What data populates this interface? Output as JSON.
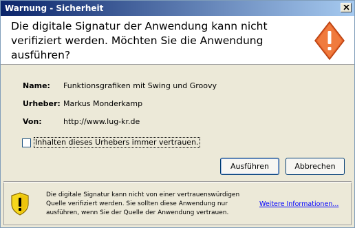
{
  "window": {
    "title": "Warnung - Sicherheit"
  },
  "header": {
    "message": "Die digitale Signatur der Anwendung kann nicht verifiziert werden.  Möchten Sie die Anwendung ausführen?"
  },
  "details": [
    {
      "label": "Name:",
      "value": "Funktionsgrafiken mit Swing und Groovy"
    },
    {
      "label": "Urheber:",
      "value": "Markus Monderkamp"
    },
    {
      "label": "Von:",
      "value": "http://www.lug-kr.de"
    }
  ],
  "trust_checkbox": {
    "label": "Inhalten dieses Urhebers immer vertrauen.",
    "checked": false
  },
  "buttons": {
    "run": "Ausführen",
    "cancel": "Abbrechen"
  },
  "footer": {
    "text": "Die digitale Signatur kann nicht von einer vertrauenswürdigen Quelle verifiziert werden. Sie sollten diese Anwendung nur ausführen, wenn Sie der Quelle der Anwendung vertrauen.",
    "link": "Weitere Informationen..."
  },
  "colors": {
    "titlebar_start": "#0a246a",
    "titlebar_end": "#a6caf0",
    "warning_orange": "#e8632a",
    "shield_yellow": "#f6d71c"
  }
}
